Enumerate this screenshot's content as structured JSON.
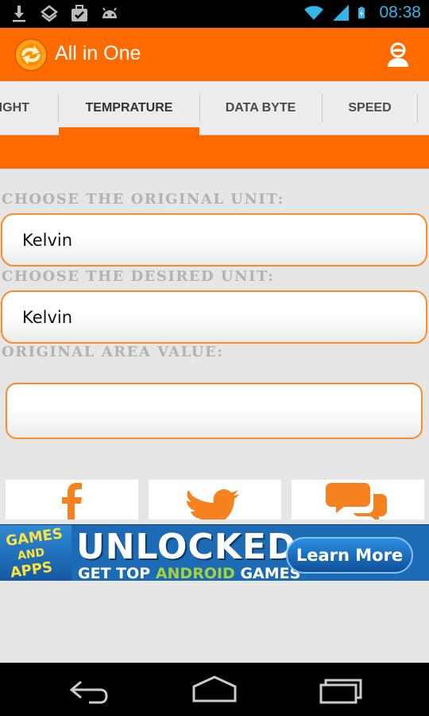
{
  "status_bar": {
    "time": "08:38",
    "icons": [
      "download-icon",
      "stack-icon",
      "briefcase-check-icon",
      "android-icon",
      "wifi-icon",
      "signal-icon",
      "battery-charging-icon"
    ]
  },
  "action_bar": {
    "title": "All in One",
    "logo_icon": "refresh-arrow-logo-icon",
    "profile_icon": "profile-icon"
  },
  "tabs": [
    {
      "label": "EIGHT",
      "active": false
    },
    {
      "label": "TEMPRATURE",
      "active": true
    },
    {
      "label": "DATA BYTE",
      "active": false
    },
    {
      "label": "SPEED",
      "active": false
    }
  ],
  "form": {
    "original_unit_label": "CHOOSE THE ORIGINAL UNIT:",
    "original_unit_value": "Kelvin",
    "desired_unit_label": "CHOOSE THE DESIRED UNIT:",
    "desired_unit_value": "Kelvin",
    "value_label": "ORIGINAL AREA VALUE:",
    "value_input": ""
  },
  "share": [
    "facebook-icon",
    "twitter-icon",
    "chat-icon"
  ],
  "ad": {
    "games_line1": "GAMES",
    "games_line2": "AND",
    "games_line3": "APPS",
    "headline": "UNLOCKED,",
    "sub_prefix": "GET TOP ",
    "sub_android": "ANDROID",
    "sub_suffix": " GAMES",
    "button": "Learn More"
  },
  "colors": {
    "accent": "#ff6b00",
    "field_border": "#ff8a2a",
    "clock": "#33b5e5"
  },
  "nav_bar": [
    "back-icon",
    "home-icon",
    "recents-icon"
  ]
}
